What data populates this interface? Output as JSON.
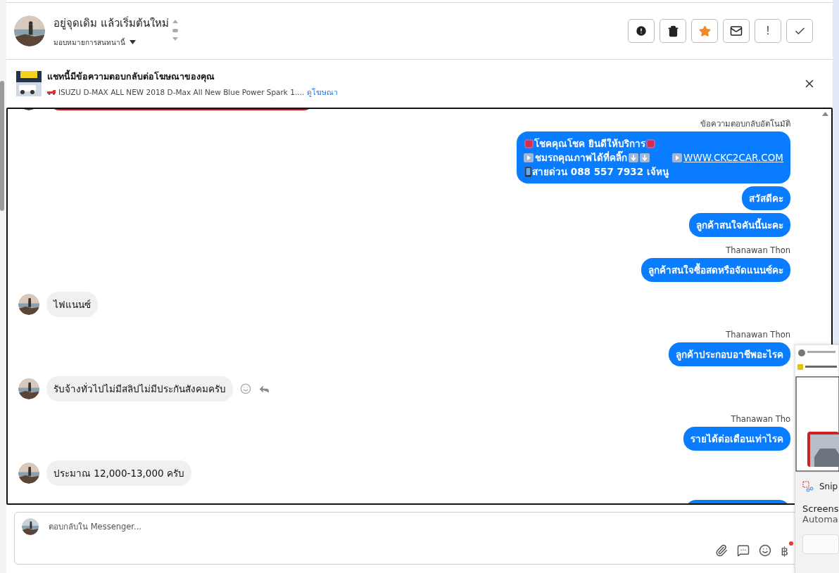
{
  "conversation": {
    "name": "อยู่จุดเดิม แล้วเริ่มต้นใหม่",
    "assign_label": "มอบหมายการสนทนานี้"
  },
  "actions": [
    {
      "kind": "alert"
    },
    {
      "kind": "trash"
    },
    {
      "kind": "star"
    },
    {
      "kind": "mail"
    },
    {
      "kind": "bang",
      "label": "!"
    },
    {
      "kind": "check"
    }
  ],
  "ad_banner": {
    "title": "แชทนี้มีข้อความตอบกลับต่อโฆษณาของคุณ",
    "ad_text": "ISUZU D-MAX ALL NEW 2018 D-Max All New Blue Power Spark 1....",
    "link": "ดูโฆษณา"
  },
  "messages": [
    {
      "kind": "peek"
    },
    {
      "kind": "outgoing",
      "sender": "ข้อความตอบกลับอัตโนมัติ",
      "lines": [
        [
          {
            "kind": "mark"
          },
          {
            "kind": "text",
            "text": "โชคคุณโชค ยินดีให้บริการ"
          },
          {
            "kind": "mark"
          }
        ],
        [
          {
            "kind": "play"
          },
          {
            "kind": "text",
            "text": "ชมรถคุณภาพได้ที่คลิ๊ก"
          },
          {
            "kind": "down"
          },
          {
            "kind": "down"
          },
          {
            "kind": "gap"
          },
          {
            "kind": "play"
          },
          {
            "kind": "link",
            "text": "WWW.CKC2CAR.COM"
          }
        ],
        [
          {
            "kind": "phone"
          },
          {
            "kind": "text",
            "text": " สายด่วน 088 557 7932 เจ้หนู"
          }
        ]
      ]
    },
    {
      "kind": "outgoing",
      "text": "สวัสดีคะ"
    },
    {
      "kind": "outgoing",
      "text": "ลูกค้าสนใจคันนี้นะคะ"
    },
    {
      "kind": "outgoing",
      "sender": "Thanawan Thon",
      "text": "ลูกค้าสนใจซื้อสดหรือจัดแนนซ์คะ"
    },
    {
      "kind": "incoming",
      "text": "ไฟแนนซ์",
      "hover_actions": false
    },
    {
      "kind": "outgoing",
      "sender": "Thanawan Thon",
      "text": "ลูกค้าประกอบอาชีพอะไรค"
    },
    {
      "kind": "incoming",
      "text": "รับจ้างทั่วไปไม่มีสลิปไม่มีประกันสังคมครับ",
      "hover_actions": true
    },
    {
      "kind": "outgoing",
      "sender": "Thanawan Tho",
      "text": "รายได้ต่อเดือนเท่าไรค"
    },
    {
      "kind": "incoming",
      "text": "ประมาณ 12,000-13,000 ครับ",
      "hover_actions": false
    },
    {
      "kind": "cut"
    }
  ],
  "composer": {
    "placeholder": "ตอบกลับใน Messenger...",
    "currency_symbol": "฿"
  },
  "snip_notification": {
    "app": "Snip",
    "title": "Screens",
    "body": "Automa"
  }
}
